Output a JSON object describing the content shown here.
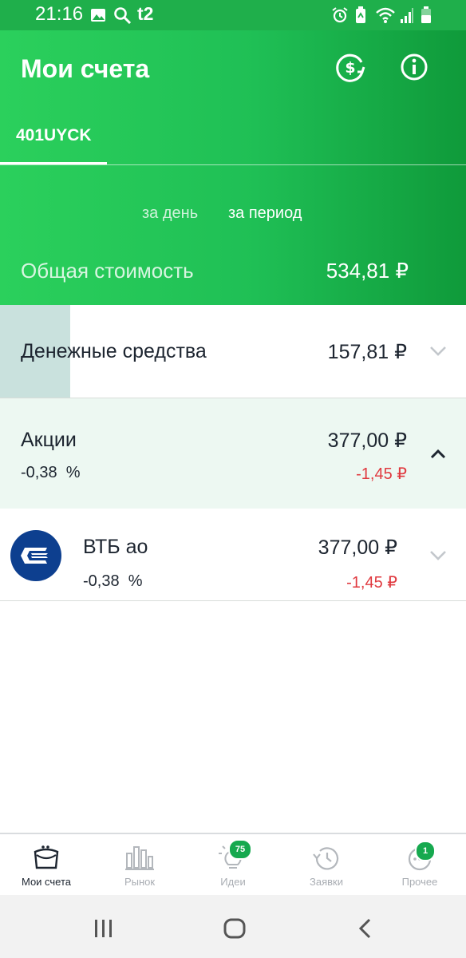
{
  "status_bar": {
    "time": "21:16",
    "icons": [
      "image-icon",
      "search-icon",
      "t2-logo",
      "alarm-icon",
      "battery-saver-icon",
      "wifi-icon",
      "signal-icon",
      "battery-icon"
    ],
    "operator": "t2"
  },
  "header": {
    "title": "Мои счета",
    "actions": [
      "currency-exchange-icon",
      "info-icon"
    ],
    "tabs": [
      {
        "label": "401UYCK",
        "active": true
      }
    ],
    "periods": [
      {
        "label": "за день",
        "active": false
      },
      {
        "label": "за период",
        "active": true
      }
    ],
    "total": {
      "label": "Общая стоимость",
      "value": "534,81 ₽"
    }
  },
  "portfolio": {
    "cash": {
      "label": "Денежные средства",
      "value": "157,81 ₽"
    },
    "stocks": {
      "label": "Акции",
      "value": "377,00 ₽",
      "percent": "-0,38  %",
      "change": "-1,45 ₽",
      "expanded": true
    },
    "positions": [
      {
        "name": "ВТБ ао",
        "value": "377,00 ₽",
        "percent": "-0,38  %",
        "change": "-1,45 ₽",
        "icon": "vtb-logo"
      }
    ]
  },
  "bottom_nav": {
    "items": [
      {
        "label": "Мои счета",
        "icon": "wallet-icon",
        "active": true
      },
      {
        "label": "Рынок",
        "icon": "market-chart-icon",
        "active": false
      },
      {
        "label": "Идеи",
        "icon": "lightbulb-icon",
        "active": false,
        "badge": "75"
      },
      {
        "label": "Заявки",
        "icon": "history-icon",
        "active": false
      },
      {
        "label": "Прочее",
        "icon": "more-icon",
        "active": false,
        "badge": "1"
      }
    ]
  },
  "colors": {
    "brand": "#21c05a",
    "negative": "#e0393f",
    "badge": "#16a94f"
  }
}
